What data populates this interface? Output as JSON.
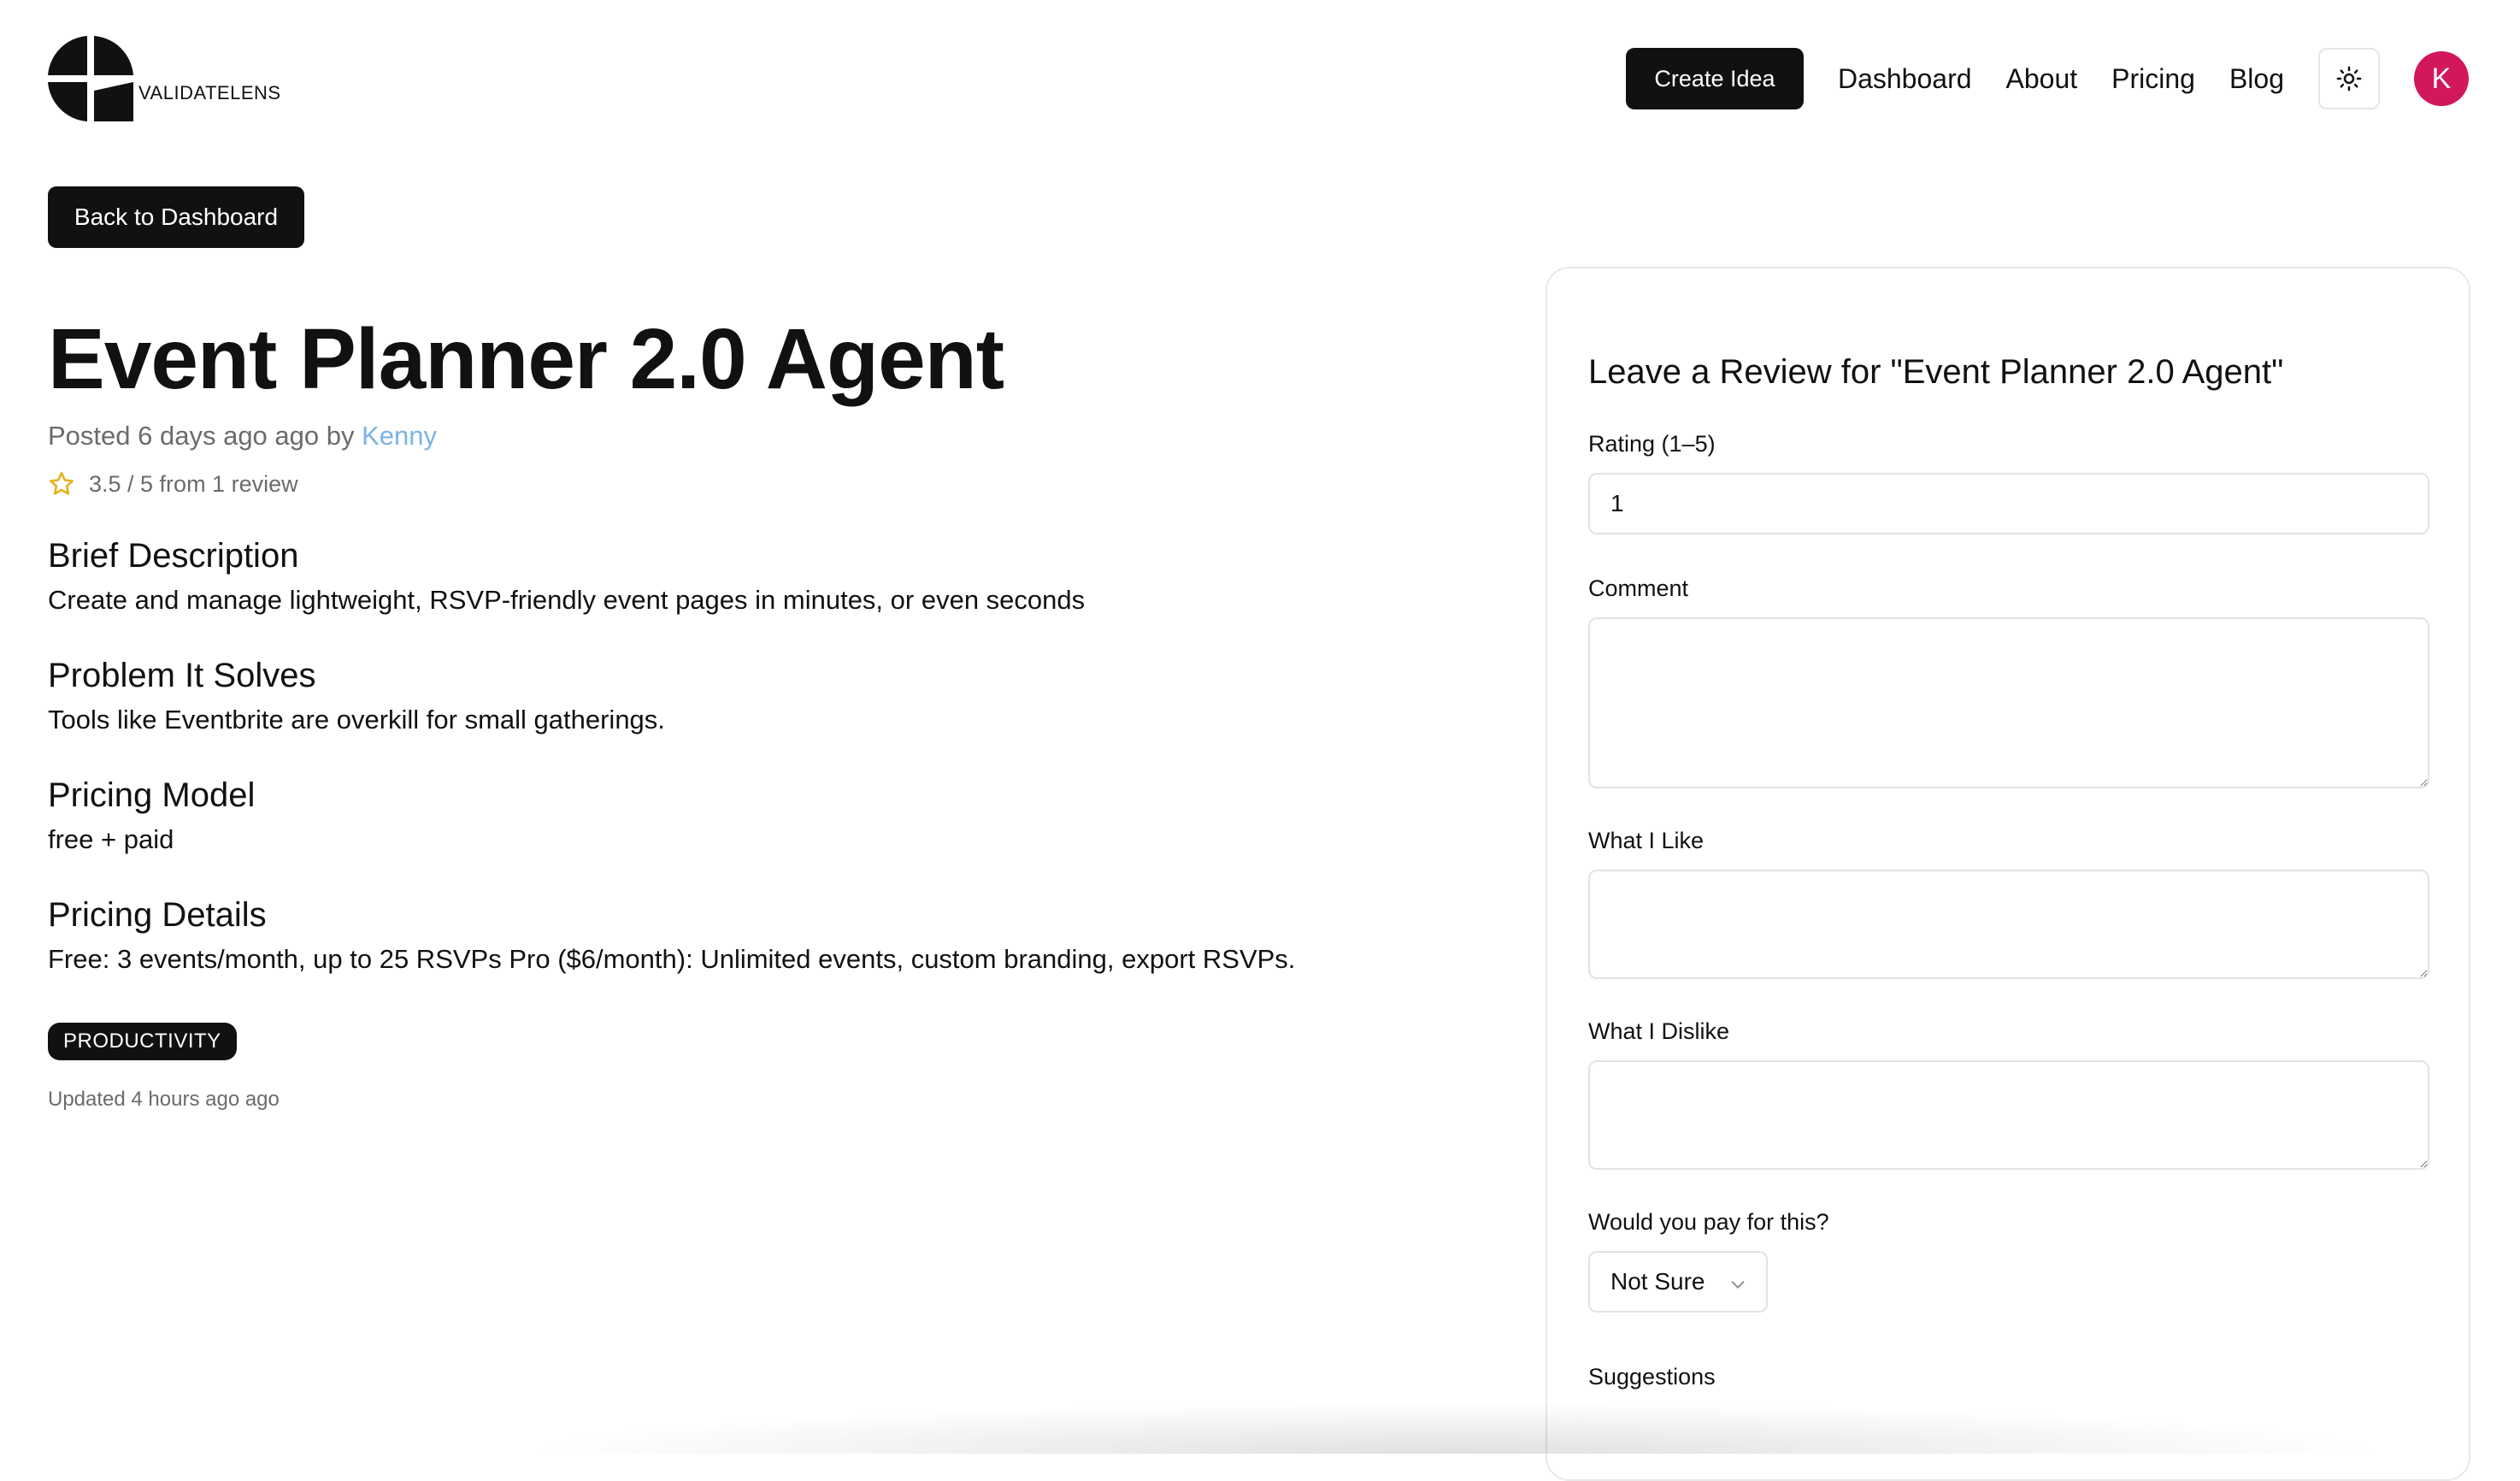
{
  "brand": {
    "name": "VALIDATELENS"
  },
  "nav": {
    "create_label": "Create Idea",
    "links": [
      "Dashboard",
      "About",
      "Pricing",
      "Blog"
    ],
    "avatar_initial": "K"
  },
  "back_label": "Back to Dashboard",
  "idea": {
    "title": "Event Planner 2.0 Agent",
    "posted_prefix": "Posted 6 days ago ago by",
    "author": "Kenny",
    "rating_text": "3.5 / 5 from 1 review",
    "sections": [
      {
        "heading": "Brief Description",
        "body": "Create and manage lightweight, RSVP-friendly event pages in minutes, or even seconds"
      },
      {
        "heading": "Problem It Solves",
        "body": "Tools like Eventbrite are overkill for small gatherings."
      },
      {
        "heading": "Pricing Model",
        "body": "free + paid"
      },
      {
        "heading": "Pricing Details",
        "body": "Free: 3 events/month, up to 25 RSVPs Pro ($6/month): Unlimited events, custom branding, export RSVPs."
      }
    ],
    "tag": "PRODUCTIVITY",
    "updated": "Updated 4 hours ago ago"
  },
  "review": {
    "title": "Leave a Review for \"Event Planner 2.0 Agent\"",
    "rating_label": "Rating (1–5)",
    "rating_value": "1",
    "comment_label": "Comment",
    "like_label": "What I Like",
    "dislike_label": "What I Dislike",
    "pay_label": "Would you pay for this?",
    "pay_value": "Not Sure",
    "suggestions_label": "Suggestions"
  },
  "colors": {
    "avatar": "#d3175d",
    "author_link": "#7ab3e6",
    "star": "#e5b321",
    "dark": "#111111"
  }
}
